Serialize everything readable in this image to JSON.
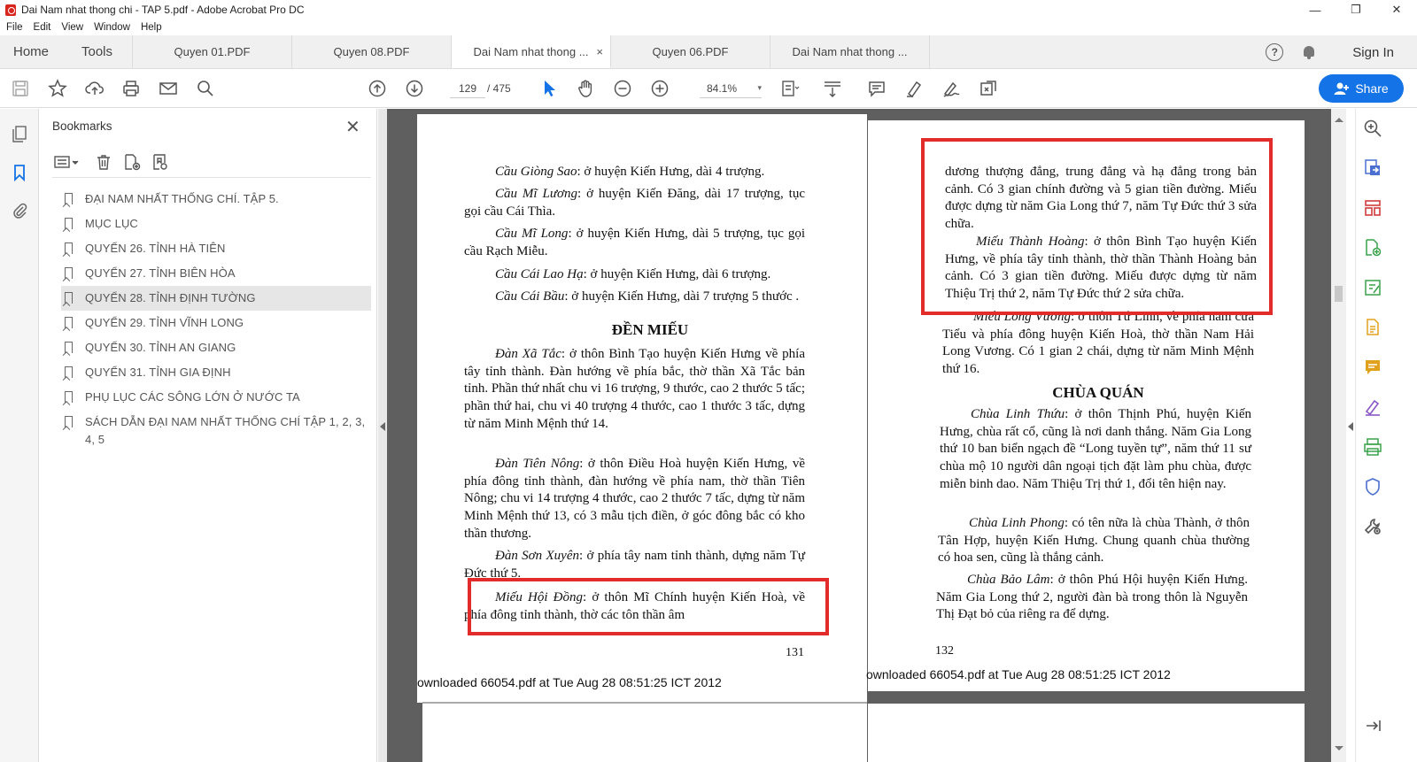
{
  "window": {
    "title": "Dai Nam nhat thong chi - TAP 5.pdf - Adobe Acrobat Pro DC",
    "minimize": "—",
    "restore": "❐",
    "close": "✕"
  },
  "menu": [
    "File",
    "Edit",
    "View",
    "Window",
    "Help"
  ],
  "tabs": {
    "home": "Home",
    "tools": "Tools",
    "documents": [
      {
        "label": "Quyen 01.PDF",
        "active": false
      },
      {
        "label": "Quyen 08.PDF",
        "active": false
      },
      {
        "label": "Dai Nam nhat thong ...",
        "active": true
      },
      {
        "label": "Quyen 06.PDF",
        "active": false
      },
      {
        "label": "Dai Nam nhat thong ...",
        "active": false
      }
    ],
    "close_glyph": "×",
    "help": "?",
    "sign_in": "Sign In"
  },
  "toolbar": {
    "page_current": "129",
    "page_total": "/ 475",
    "zoom": "84.1%",
    "zoom_dropdown": "▾",
    "share_label": "Share"
  },
  "bookmarks": {
    "title": "Bookmarks",
    "close": "✕",
    "items": [
      {
        "label": "ĐẠI NAM NHẤT THỐNG CHÍ. TẬP 5.",
        "selected": false
      },
      {
        "label": "MỤC LỤC",
        "selected": false
      },
      {
        "label": "QUYỂN 26. TỈNH HÀ TIÊN",
        "selected": false
      },
      {
        "label": "QUYỂN 27. TỈNH BIÊN HÒA",
        "selected": false
      },
      {
        "label": "QUYỂN 28. TỈNH ĐỊNH TƯỜNG",
        "selected": true
      },
      {
        "label": "QUYỂN 29. TỈNH VĨNH LONG",
        "selected": false
      },
      {
        "label": "QUYỂN 30. TỈNH AN GIANG",
        "selected": false
      },
      {
        "label": "QUYỂN 31. TỈNH GIA ĐỊNH",
        "selected": false
      },
      {
        "label": "PHỤ LỤC CÁC SÔNG LỚN Ở NƯỚC TA",
        "selected": false
      },
      {
        "label": "SÁCH DẪN ĐẠI NAM NHẤT THỐNG CHÍ TẬP 1, 2, 3, 4, 5",
        "selected": false
      }
    ]
  },
  "left_page": {
    "p1": {
      "title": "Cầu Giòng Sao",
      "text": ": ở huyện Kiến Hưng, dài 4 trượng."
    },
    "p2": {
      "title": "Cầu Mĩ Lương",
      "text": ": ở huyện Kiến Đăng, dài 17 trượng, tục gọi cầu Cái Thìa."
    },
    "p3": {
      "title": "Cầu Mĩ Long",
      "text": ": ở huyện Kiến Hưng, dài 5 trượng, tục gọi cầu Rạch Miễu."
    },
    "p4": {
      "title": "Cầu Cái Lao Hạ",
      "text": ": ở huyện Kiến Hưng, dài 6 trượng."
    },
    "p5": {
      "title": "Cầu Cái Bầu",
      "text": ": ở huyện Kiến Hưng, dài 7 trượng 5 thước ."
    },
    "heading": "ĐỀN MIẾU",
    "p6": {
      "title": "Đàn Xã Tắc",
      "text": ": ở thôn Bình Tạo huyện Kiến Hưng về phía tây tỉnh thành. Đàn hướng về phía bắc, thờ thần Xã Tắc bản tỉnh. Phần thứ nhất chu vi 16 trượng, 9 thước, cao 2 thước 5 tấc; phần thứ hai, chu vi 40 trượng 4 thước, cao 1 thước 3 tấc, dựng từ năm Minh Mệnh thứ 14."
    },
    "p7": {
      "title": "Đàn Tiên Nông",
      "text": ": ở thôn Điều Hoà huyện Kiến Hưng, về phía đông tỉnh thành, đàn hướng về phía nam, thờ thần Tiên Nông; chu vi 14 trượng 4 thước, cao 2 thước 7 tấc, dựng từ năm Minh Mệnh thứ 13, có 3 mẫu tịch điền, ở góc đông bắc có kho thần thương."
    },
    "p8": {
      "title": "Đàn Sơn Xuyên",
      "text": ": ở phía tây nam tỉnh thành, dựng năm Tự Đức thứ 5."
    },
    "p9": {
      "title": "Miếu Hội Đồng",
      "text": ": ở thôn Mĩ Chính huyện Kiến Hoà, về phía đông tỉnh thành, thờ các tôn thần âm"
    },
    "page_number": "131",
    "footer": "ownloaded 66054.pdf at Tue Aug 28 08:51:25 ICT 2012"
  },
  "right_page": {
    "p1": {
      "text": "dương thượng đẳng, trung đẳng và hạ đẳng trong bản cảnh. Có 3 gian chính đường và 5 gian tiền đường. Miếu được dựng từ năm Gia Long thứ 7, năm Tự Đức thứ 3 sửa chữa."
    },
    "p2": {
      "title": "Miếu Thành Hoàng",
      "text": ": ở thôn Bình Tạo huyện Kiến Hưng, về phía tây tỉnh thành, thờ thần Thành Hoàng bản cảnh. Có 3 gian tiền đường. Miếu được dựng từ năm Thiệu Trị thứ 2, năm Tự Đức thứ 2 sửa chữa."
    },
    "p3": {
      "title": "Miếu Long Vương",
      "text": ": ở thôn Tứ Linh, về phía nam cửa Tiểu và phía đông huyện Kiến Hoà, thờ thần Nam Hải Long Vương. Có 1 gian 2 chái, dựng từ năm Minh Mệnh thứ 16."
    },
    "heading": "CHÙA QUÁN",
    "p4": {
      "title": "Chùa Linh Thứu",
      "text": ": ở thôn Thịnh Phú, huyện Kiến Hưng, chùa rất cổ, cũng là nơi danh thắng. Năm Gia Long thứ 10 ban biển ngạch đề “Long tuyền tự”, năm thứ 11 sư chùa mộ 10 người dân ngoại tịch đặt làm phu chùa, được miễn binh dao. Năm Thiệu Trị thứ 1, đổi tên hiện nay."
    },
    "p5": {
      "title": "Chùa Linh Phong",
      "text": ": có tên nữa là chùa Thành, ở thôn Tân Hợp, huyện Kiến Hưng. Chung quanh chùa thường có hoa sen, cũng là thắng cảnh."
    },
    "p6": {
      "title": "Chùa Bảo Lâm",
      "text": ": ở thôn Phú Hội huyện Kiến Hưng. Năm Gia Long thứ 2, người đàn bà trong thôn là Nguyễn Thị Đạt bỏ của riêng ra để dựng."
    },
    "page_number": "132",
    "footer": "ownloaded 66054.pdf at Tue Aug 28 08:51:25 ICT 2012"
  },
  "colors": {
    "accent": "#1473e6",
    "annotation_red": "#e22c2c",
    "canvas": "#5f5f5f"
  }
}
